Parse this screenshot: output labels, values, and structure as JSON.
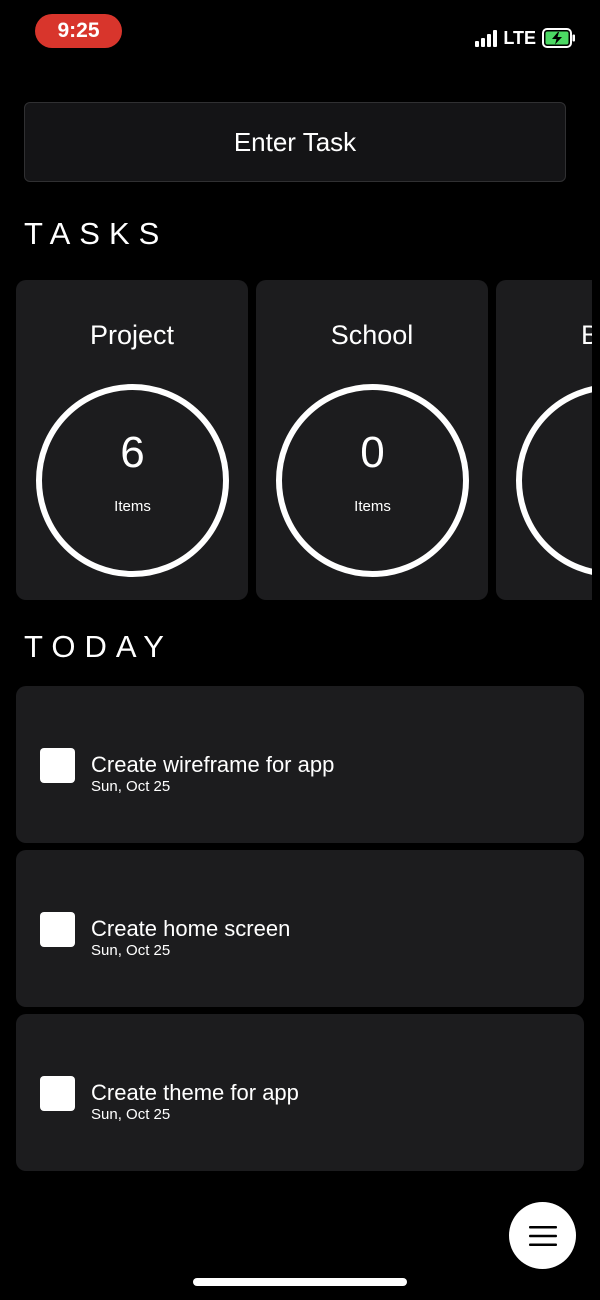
{
  "status_bar": {
    "time": "9:25",
    "network": "LTE",
    "icons": [
      "signal-icon",
      "battery-charging-icon"
    ],
    "time_pill_color": "#d8352c",
    "battery_color": "#4cd964"
  },
  "input": {
    "label": "Enter Task"
  },
  "tasks_section": {
    "title": "TASKS",
    "categories": [
      {
        "name": "Project",
        "count": "6",
        "unit": "Items"
      },
      {
        "name": "School",
        "count": "0",
        "unit": "Items"
      },
      {
        "name": "B",
        "count": "",
        "unit": ""
      }
    ]
  },
  "today_section": {
    "title": "TODAY",
    "items": [
      {
        "title": "Create wireframe for app",
        "date": "Sun, Oct 25",
        "checked": false
      },
      {
        "title": "Create home screen",
        "date": "Sun, Oct 25",
        "checked": false
      },
      {
        "title": "Create theme for app",
        "date": "Sun, Oct 25",
        "checked": false
      }
    ]
  },
  "fab": {
    "icon": "menu-icon"
  },
  "theme": {
    "background": "#000000",
    "card": "#1c1c1e",
    "text": "#ffffff"
  }
}
